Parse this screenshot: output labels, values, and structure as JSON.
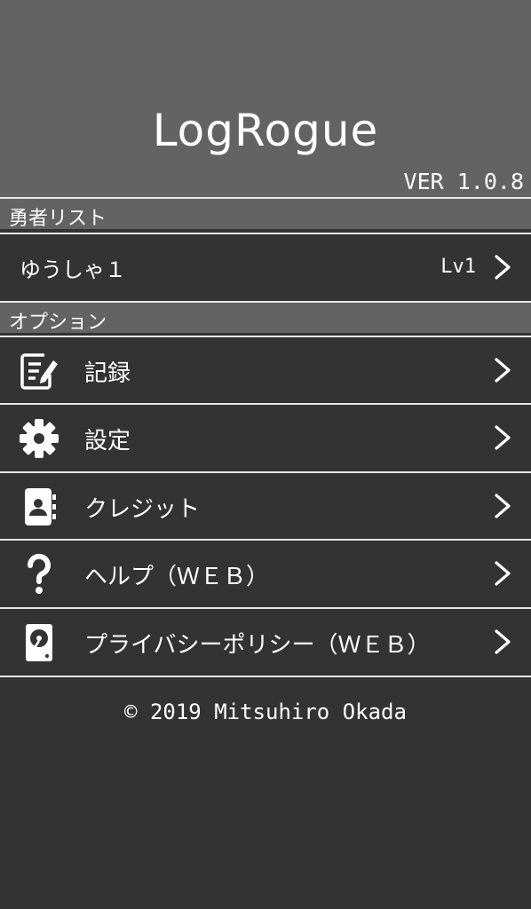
{
  "app": {
    "title": "LogRogue",
    "version": "VER 1.0.8"
  },
  "hero_section": {
    "header": "勇者リスト",
    "items": [
      {
        "name": "ゆうしゃ１",
        "level": "Lv1"
      }
    ]
  },
  "option_section": {
    "header": "オプション",
    "items": [
      {
        "label": "記録",
        "icon": "edit-note-icon"
      },
      {
        "label": "設定",
        "icon": "gear-icon"
      },
      {
        "label": "クレジット",
        "icon": "contacts-book-icon"
      },
      {
        "label": "ヘルプ（ＷＥＢ）",
        "icon": "question-mark-icon"
      },
      {
        "label": "プライバシーポリシー（ＷＥＢ）",
        "icon": "hard-drive-icon"
      }
    ]
  },
  "footer": {
    "copyright": "© 2019 Mitsuhiro Okada"
  },
  "colors": {
    "header_bg": "#636363",
    "body_bg": "#333333",
    "divider": "#e6e6e6",
    "text": "#ffffff"
  }
}
